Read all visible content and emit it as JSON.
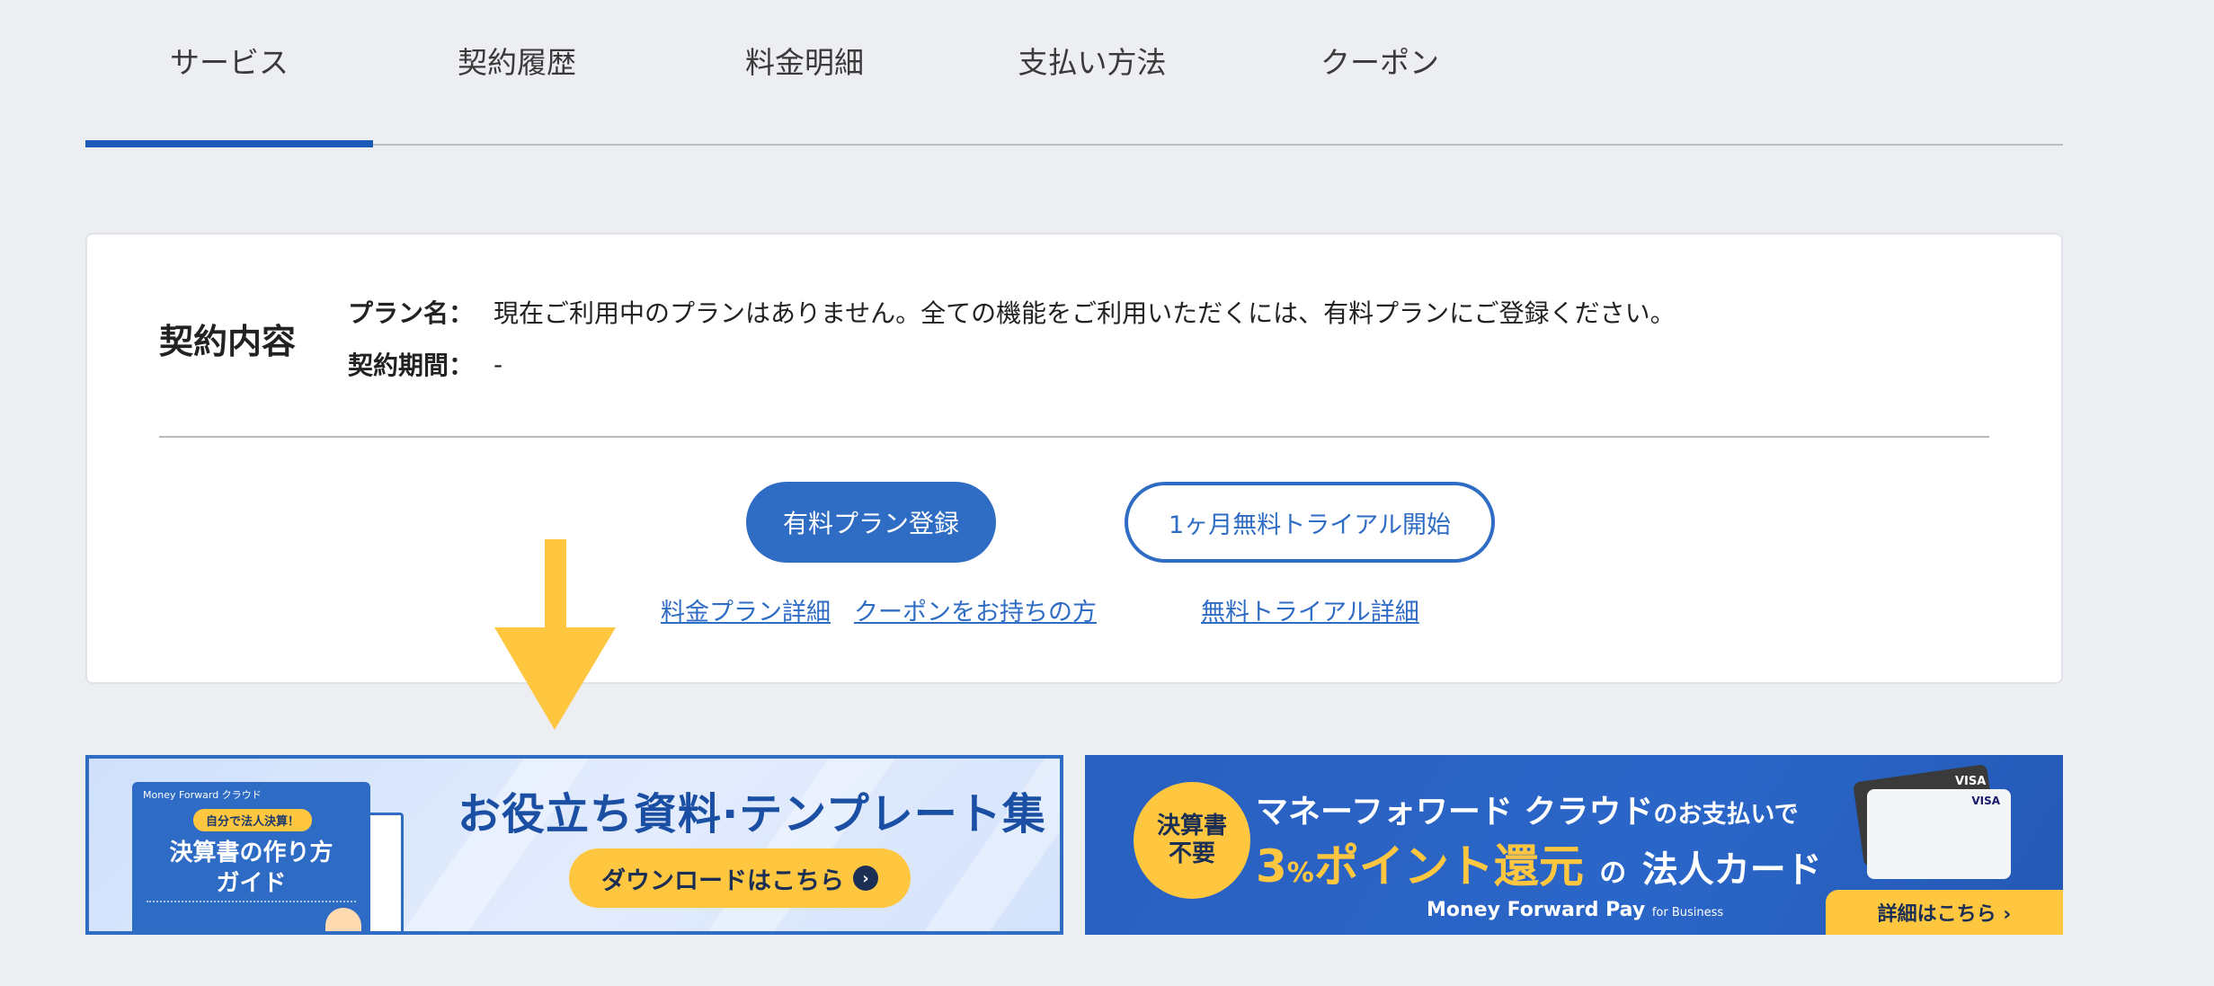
{
  "tabs": [
    {
      "label": "サービス",
      "active": true
    },
    {
      "label": "契約履歴",
      "active": false
    },
    {
      "label": "料金明細",
      "active": false
    },
    {
      "label": "支払い方法",
      "active": false
    },
    {
      "label": "クーポン",
      "active": false
    }
  ],
  "contract": {
    "title": "契約内容",
    "plan_label": "プラン名：",
    "plan_value": "現在ご利用中のプランはありません。全ての機能をご利用いただくには、有料プランにご登録ください。",
    "period_label": "契約期間：",
    "period_value": "-",
    "paid_plan_button": "有料プラン登録",
    "trial_button": "1ヶ月無料トライアル開始",
    "links": {
      "plan_details": "料金プラン詳細",
      "coupon": "クーポンをお持ちの方",
      "trial_details": "無料トライアル詳細"
    }
  },
  "banner_templates": {
    "brand": "Money Forward クラウド",
    "pill": "自分で法人決算！",
    "book_title_1": "決算書の作り方",
    "book_title_2": "ガイド",
    "headline": "お役立ち資料·テンプレート集",
    "download": "ダウンロードはこちら"
  },
  "banner_card": {
    "badge_1": "決算書",
    "badge_2": "不要",
    "line1_main": "マネーフォワード クラウド",
    "line1_suffix": "のお支払いで",
    "line2_num": "3",
    "line2_pct": "%",
    "line2_main": "ポイント還元",
    "line2_no": "の",
    "line2_end": "法人カード",
    "logo": "Money Forward Pay",
    "logo_suffix": "for Business",
    "visa": "VISA",
    "detail": "詳細はこちら ›"
  },
  "colors": {
    "accent": "#2f6cc4",
    "tab_active": "#1b5bb8",
    "arrow": "#ffc640",
    "background": "#eceef2"
  }
}
